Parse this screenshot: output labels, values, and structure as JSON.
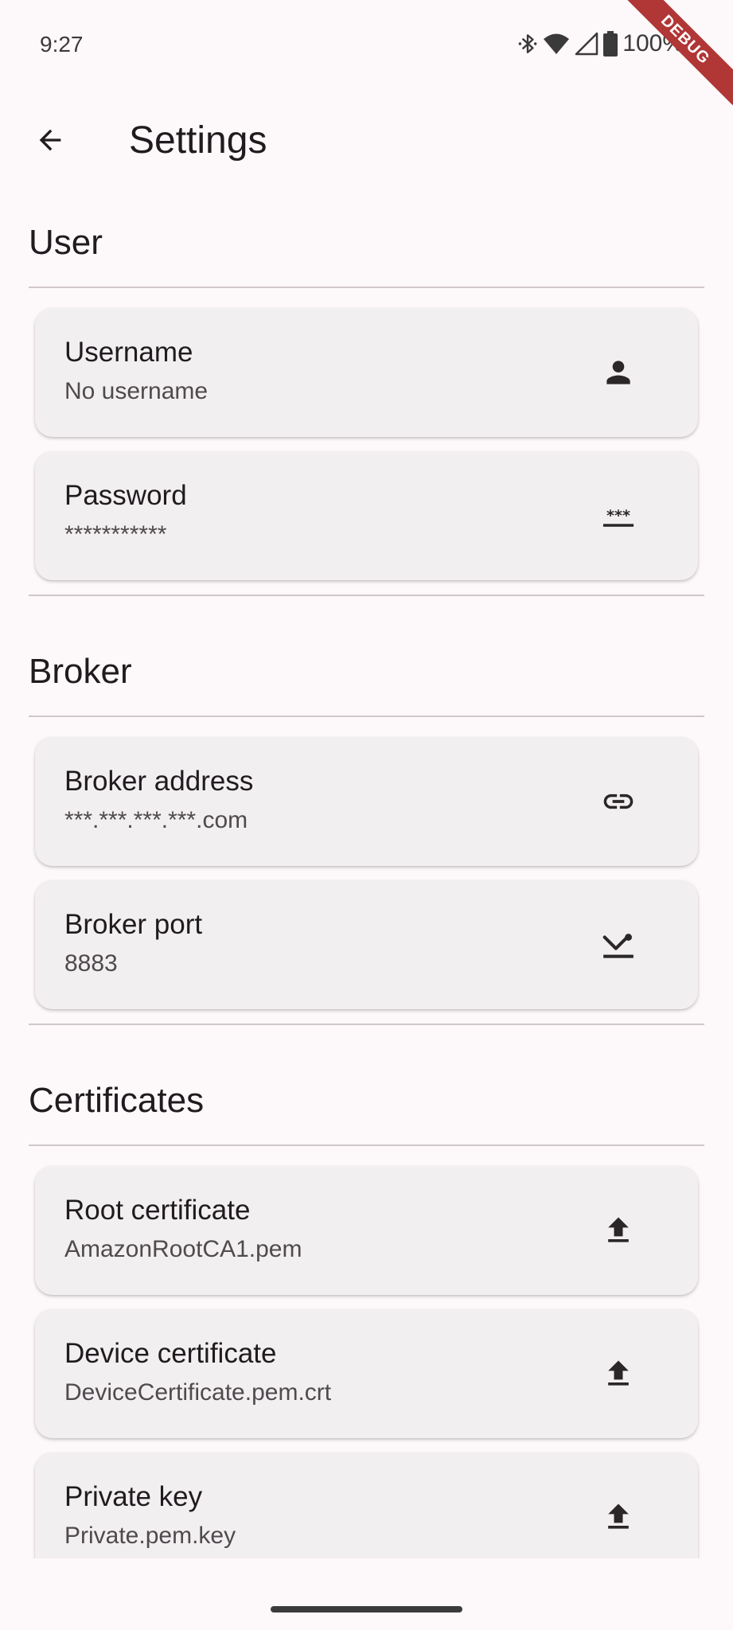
{
  "status_bar": {
    "time": "9:27",
    "battery_text": "100%",
    "icons": [
      "bluetooth-icon",
      "wifi-icon",
      "cell-signal-icon",
      "battery-icon"
    ]
  },
  "debug_banner": "DEBUG",
  "app_bar": {
    "title": "Settings",
    "back_icon": "arrow-back-icon"
  },
  "sections": {
    "user": {
      "title": "User",
      "items": [
        {
          "title": "Username",
          "subtitle": "No username",
          "icon": "person-icon"
        },
        {
          "title": "Password",
          "subtitle": "***********",
          "icon": "password-icon"
        }
      ]
    },
    "broker": {
      "title": "Broker",
      "items": [
        {
          "title": "Broker address",
          "subtitle": "***.***.***.***.com",
          "icon": "link-icon"
        },
        {
          "title": "Broker port",
          "subtitle": "8883",
          "icon": "port-icon"
        }
      ]
    },
    "certificates": {
      "title": "Certificates",
      "items": [
        {
          "title": "Root certificate",
          "subtitle": "AmazonRootCA1.pem",
          "icon": "upload-icon"
        },
        {
          "title": "Device certificate",
          "subtitle": "DeviceCertificate.pem.crt",
          "icon": "upload-icon"
        },
        {
          "title": "Private key",
          "subtitle": "Private.pem.key",
          "icon": "upload-icon"
        }
      ]
    }
  },
  "colors": {
    "background": "#fdf8fa",
    "card": "#f2eff1",
    "text": "#1f1b1e",
    "subtext": "#4f4a4d",
    "divider": "#cfc8cb",
    "debug_ribbon": "#b13636"
  }
}
